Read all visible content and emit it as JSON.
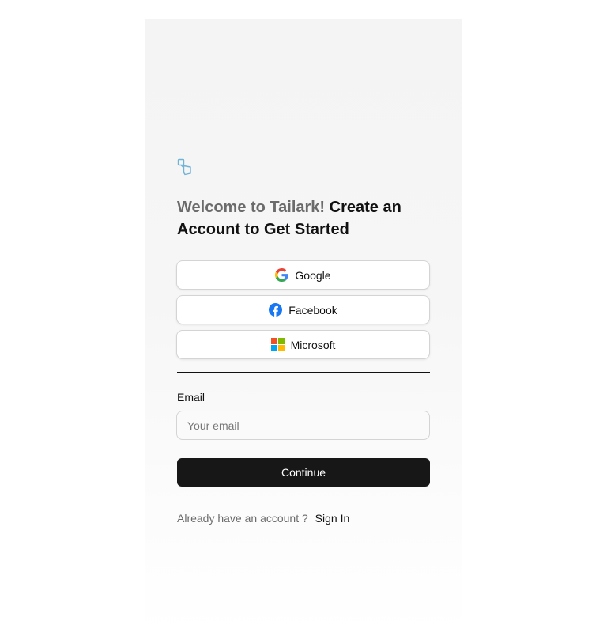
{
  "brand": {
    "logo_icon": "tailark-logo-icon",
    "accent_color": "#6fb3d6"
  },
  "heading": {
    "muted": "Welcome to Tailark!",
    "strong": "Create an Account to Get Started"
  },
  "social_buttons": [
    {
      "label": "Google",
      "icon": "google-icon"
    },
    {
      "label": "Facebook",
      "icon": "facebook-icon"
    },
    {
      "label": "Microsoft",
      "icon": "microsoft-icon"
    }
  ],
  "form": {
    "email_label": "Email",
    "email_placeholder": "Your email",
    "email_value": "",
    "continue_label": "Continue"
  },
  "footer": {
    "prompt": "Already have an account ?",
    "signin_label": "Sign In"
  },
  "colors": {
    "primary_button": "#171717",
    "muted_text": "#6b6b6b",
    "border": "#d4d4d4"
  }
}
